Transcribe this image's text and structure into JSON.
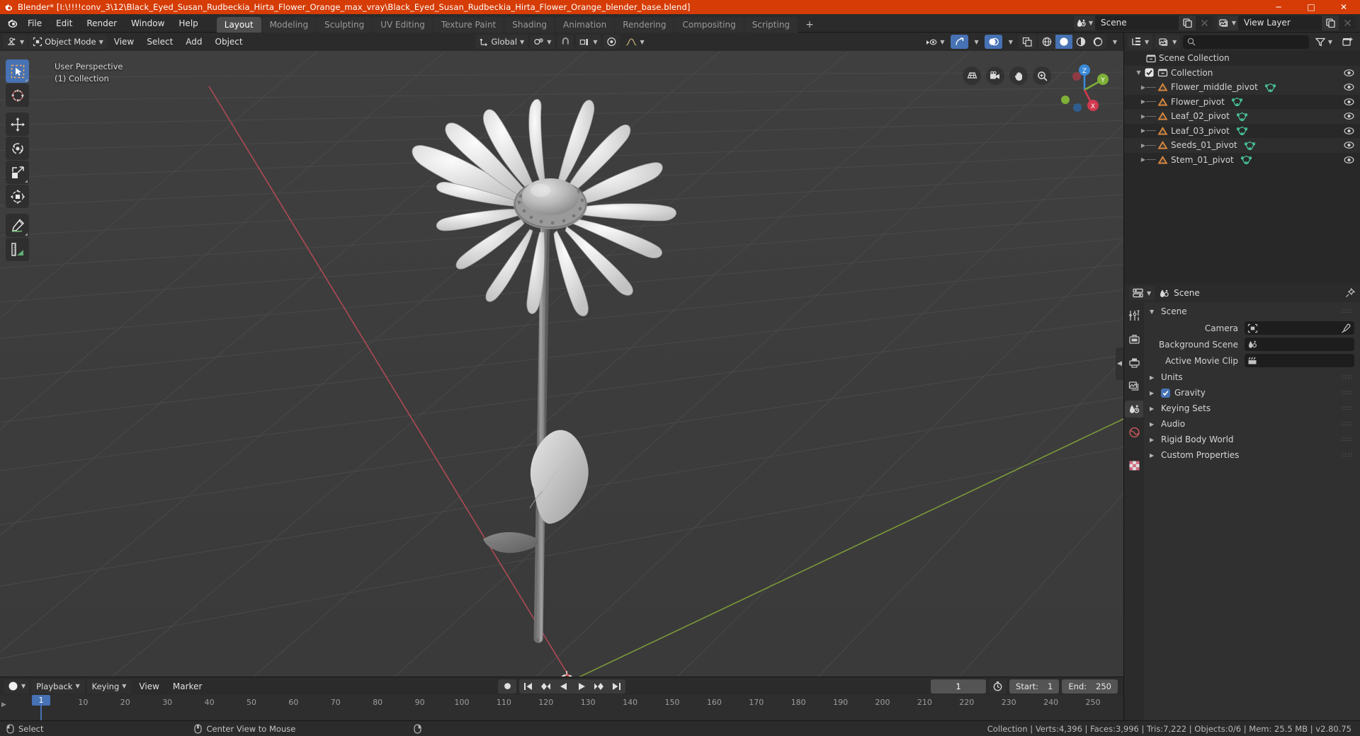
{
  "titlebar": {
    "text": "Blender* [I:\\!!!!conv_3\\12\\Black_Eyed_Susan_Rudbeckia_Hirta_Flower_Orange_max_vray\\Black_Eyed_Susan_Rudbeckia_Hirta_Flower_Orange_blender_base.blend]",
    "minimize": "─",
    "maximize": "□",
    "close": "✕",
    "accent_color": "#d63c06"
  },
  "topbar": {
    "menus": [
      "File",
      "Edit",
      "Render",
      "Window",
      "Help"
    ],
    "workspaces": [
      {
        "label": "Layout",
        "active": true
      },
      {
        "label": "Modeling",
        "active": false
      },
      {
        "label": "Sculpting",
        "active": false
      },
      {
        "label": "UV Editing",
        "active": false
      },
      {
        "label": "Texture Paint",
        "active": false
      },
      {
        "label": "Shading",
        "active": false
      },
      {
        "label": "Animation",
        "active": false
      },
      {
        "label": "Rendering",
        "active": false
      },
      {
        "label": "Compositing",
        "active": false
      },
      {
        "label": "Scripting",
        "active": false
      }
    ],
    "add_workspace": "+",
    "scene_name": "Scene",
    "view_layer_name": "View Layer"
  },
  "viewport_header": {
    "mode": "Object Mode",
    "menus": [
      "View",
      "Select",
      "Add",
      "Object"
    ],
    "transform_orientation": "Global"
  },
  "viewport": {
    "perspective_label": "User Perspective",
    "collection_label": "(1) Collection",
    "gizmo_axes": {
      "z": "Z",
      "y": "Y",
      "x": "X"
    },
    "background_color": "#3c3c3c",
    "grid_color": "#4a4a4a",
    "axis_x_color": "#cf5060",
    "axis_y_color": "#88b13a"
  },
  "toolbar": {
    "tools": [
      {
        "name": "tweak-select-box",
        "active": true
      },
      {
        "name": "cursor",
        "active": false
      },
      {
        "name": "move",
        "active": false
      },
      {
        "name": "rotate",
        "active": false
      },
      {
        "name": "scale",
        "active": false
      },
      {
        "name": "transform",
        "active": false
      },
      {
        "name": "annotate",
        "active": false
      },
      {
        "name": "measure",
        "active": false
      }
    ]
  },
  "outliner": {
    "scene_collection": "Scene Collection",
    "collection": "Collection",
    "items": [
      {
        "label": "Flower_middle_pivot"
      },
      {
        "label": "Flower_pivot"
      },
      {
        "label": "Leaf_02_pivot"
      },
      {
        "label": "Leaf_03_pivot"
      },
      {
        "label": "Seeds_01_pivot"
      },
      {
        "label": "Stem_01_pivot"
      }
    ]
  },
  "properties": {
    "breadcrumb": "Scene",
    "panel_title": "Scene",
    "rows": [
      {
        "label": "Camera",
        "value": ""
      },
      {
        "label": "Background Scene",
        "value": ""
      },
      {
        "label": "Active Movie Clip",
        "value": ""
      }
    ],
    "sections": [
      {
        "label": "Units",
        "checkbox": false
      },
      {
        "label": "Gravity",
        "checkbox": true
      },
      {
        "label": "Keying Sets",
        "checkbox": false
      },
      {
        "label": "Audio",
        "checkbox": false
      },
      {
        "label": "Rigid Body World",
        "checkbox": false
      },
      {
        "label": "Custom Properties",
        "checkbox": false
      }
    ]
  },
  "timeline": {
    "menus": [
      "Playback",
      "Keying",
      "View",
      "Marker"
    ],
    "current_frame": "1",
    "start_label": "Start:",
    "start_value": "1",
    "end_label": "End:",
    "end_value": "250",
    "ticks": [
      "10",
      "20",
      "30",
      "40",
      "50",
      "60",
      "70",
      "80",
      "90",
      "100",
      "110",
      "120",
      "130",
      "140",
      "150",
      "160",
      "170",
      "180",
      "190",
      "200",
      "210",
      "220",
      "230",
      "240",
      "250"
    ],
    "playhead_frame": "1"
  },
  "statusbar": {
    "mouse_select": "Select",
    "mouse_center": "Center View to Mouse",
    "stats": "Collection | Verts:4,396 | Faces:3,996 | Tris:7,222 | Objects:0/6 | Mem: 25.5 MB | v2.80.75"
  }
}
